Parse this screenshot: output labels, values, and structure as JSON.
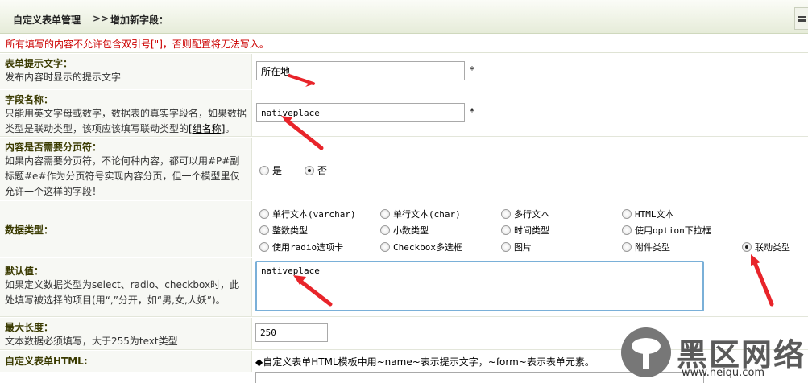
{
  "header": {
    "crumb_parent": "自定义表单管理",
    "crumb_separator": ">>",
    "crumb_current": "增加新字段："
  },
  "warning": "所有填写的内容不允许包含双引号[\"]，否则配置将无法写入。",
  "required_mark": "*",
  "fields": {
    "prompt": {
      "title": "表单提示文字：",
      "desc": "发布内容时显示的提示文字",
      "value": "所在地"
    },
    "field_name": {
      "title": "字段名称：",
      "desc_part1": "只能用英文字母或数字，数据表的真实字段名，如果数据类型是联动类型，该项应该填写联动类型的",
      "desc_link": "[组名称]",
      "desc_part2": "。",
      "value": "nativeplace"
    },
    "pagination": {
      "title": "内容是否需要分页符：",
      "desc": "如果内容需要分页符，不论何种内容，都可以用#P#副标题#e#作为分页符号实现内容分页，但一个模型里仅允许一个这样的字段！",
      "options": [
        "是",
        "否"
      ],
      "selected": "否"
    },
    "data_type": {
      "title": "数据类型：",
      "options": [
        "单行文本(varchar)",
        "单行文本(char)",
        "多行文本",
        "HTML文本",
        "整数类型",
        "小数类型",
        "时间类型",
        "使用option下拉框",
        "使用radio选项卡",
        "Checkbox多选框",
        "图片",
        "附件类型",
        "联动类型"
      ],
      "selected": "联动类型"
    },
    "default_value": {
      "title": "默认值：",
      "desc": "如果定义数据类型为select、radio、checkbox时，此处填写被选择的项目(用“,”分开，如“男,女,人妖”)。",
      "value": "nativeplace"
    },
    "max_length": {
      "title": "最大长度：",
      "desc": "文本数据必须填写，大于255为text类型",
      "value": "250"
    },
    "custom_html": {
      "title": "自定义表单HTML:",
      "note": "◆自定义表单HTML模板中用~name~表示提示文字，~form~表示表单元素。"
    }
  },
  "watermark": {
    "text": "黑区网络",
    "url": "www.heiqu.com"
  },
  "colors": {
    "arrow": "#e8242a",
    "warning": "#cc0000",
    "label_title": "#3a3a00"
  }
}
